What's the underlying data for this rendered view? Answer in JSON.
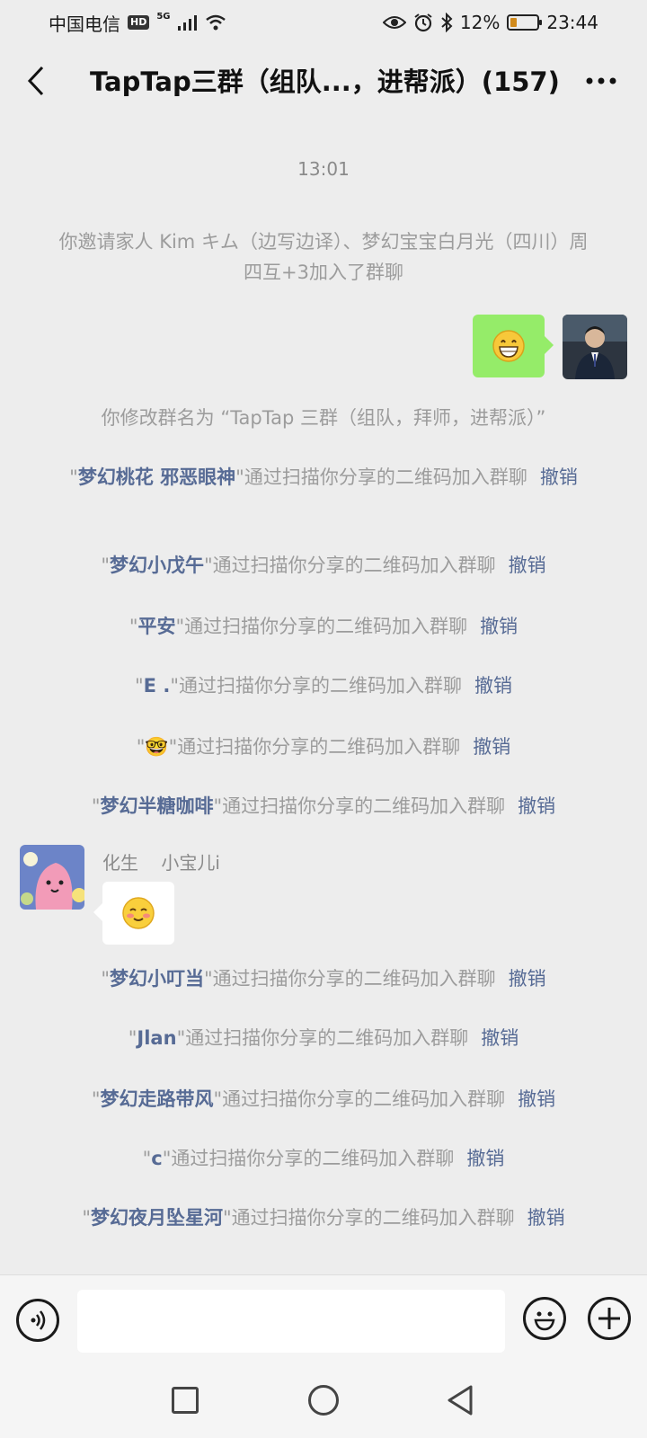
{
  "status": {
    "carrier": "中国电信",
    "hd": "HD",
    "net": "5G",
    "battery": "12%",
    "time": "23:44"
  },
  "header": {
    "title": "TapTap三群（组队...，进帮派）(157)"
  },
  "chat": {
    "timestamp": "13:01",
    "invite_msg": "你邀请家人 Kim キム（边写边译）、梦幻宝宝白月光（四川）周四互+3加入了群聊",
    "rename_msg": "你修改群名为 “TapTap 三群（组队，拜师，进帮派）”",
    "scan_suffix": "\"通过扫描你分享的二维码加入群聊",
    "revoke_label": "撤销",
    "joins_top": [
      {
        "name": "梦幻桃花 邪恶眼神"
      },
      {
        "name": "梦幻小戊午"
      },
      {
        "name": "平安"
      },
      {
        "name": "E ."
      },
      {
        "name": "🤓"
      },
      {
        "name": "梦幻半糖咖啡"
      }
    ],
    "other_sender": "化生    小宝儿i",
    "joins_bottom": [
      {
        "name": "梦幻小叮当"
      },
      {
        "name": "Jlan"
      },
      {
        "name": "梦幻走路带风"
      },
      {
        "name": "c"
      },
      {
        "name": "梦幻夜月坠星河"
      }
    ]
  },
  "input": {
    "placeholder": ""
  },
  "colors": {
    "link": "#576b95",
    "bubble_me": "#95ec69",
    "system_text": "#9c9c9c"
  }
}
